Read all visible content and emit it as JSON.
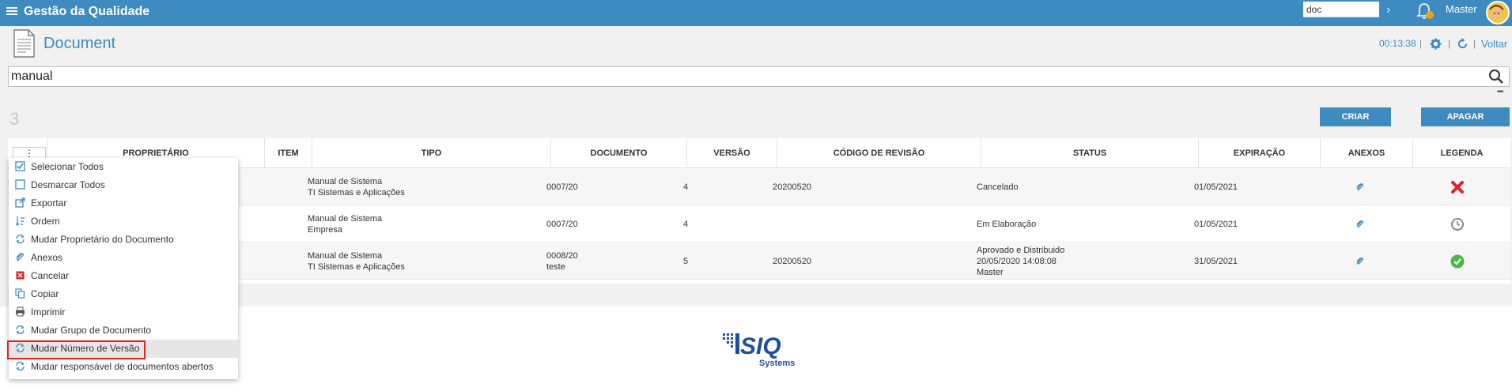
{
  "app": {
    "title": "Gestão da Qualidade"
  },
  "topbar": {
    "search_value": "doc",
    "user_name": "Master"
  },
  "page": {
    "title": "Document",
    "timer": "00:13:38",
    "back_label": "Voltar"
  },
  "search": {
    "value": "manual"
  },
  "results": {
    "count": "3"
  },
  "actions": {
    "create_label": "CRIAR",
    "delete_label": "APAGAR"
  },
  "table": {
    "menu_toggle": "⋮",
    "columns": [
      "PROPRIETÁRIO",
      "ITEM",
      "TIPO",
      "DOCUMENTO",
      "VERSÃO",
      "CÓDIGO DE REVISÃO",
      "STATUS",
      "EXPIRAÇÃO",
      "ANEXOS",
      "LEGENDA"
    ],
    "rows": [
      {
        "tipo_1": "Manual de Sistema",
        "tipo_2": "TI Sistemas e Aplicações",
        "documento_1": "0007/20",
        "documento_2": "",
        "versao": "4",
        "codigo_revisao": "20200520",
        "status_1": "Cancelado",
        "status_2": "",
        "status_3": "",
        "expiracao": "01/05/2021",
        "legenda": "cancelled-icon"
      },
      {
        "tipo_1": "Manual de Sistema",
        "tipo_2": "Empresa",
        "documento_1": "0007/20",
        "documento_2": "",
        "versao": "4",
        "codigo_revisao": "",
        "status_1": "Em Elaboração",
        "status_2": "",
        "status_3": "",
        "expiracao": "01/05/2021",
        "legenda": "clock-icon"
      },
      {
        "tipo_1": "Manual de Sistema",
        "tipo_2": "TI Sistemas e Aplicações",
        "documento_1": "0008/20",
        "documento_2": "teste",
        "versao": "5",
        "codigo_revisao": "20200520",
        "status_1": "Aprovado e Distribuido",
        "status_2": "20/05/2020 14:08:08",
        "status_3": "Master",
        "expiracao": "31/05/2021",
        "legenda": "check-icon"
      }
    ]
  },
  "menu": {
    "items": [
      {
        "label": "Selecionar Todos",
        "icon": "checkbox-checked-icon"
      },
      {
        "label": "Desmarcar Todos",
        "icon": "checkbox-empty-icon"
      },
      {
        "label": "Exportar",
        "icon": "export-icon"
      },
      {
        "label": "Ordem",
        "icon": "sort-icon"
      },
      {
        "label": "Mudar Proprietário do Documento",
        "icon": "refresh-icon"
      },
      {
        "label": "Anexos",
        "icon": "paperclip-icon"
      },
      {
        "label": "Cancelar",
        "icon": "cancel-icon"
      },
      {
        "label": "Copiar",
        "icon": "copy-icon"
      },
      {
        "label": "Imprimir",
        "icon": "printer-icon"
      },
      {
        "label": "Mudar Grupo de Documento",
        "icon": "refresh-icon"
      },
      {
        "label": "Mudar Número de Versão",
        "icon": "refresh-icon"
      },
      {
        "label": "Mudar responsável de documentos abertos",
        "icon": "refresh-icon"
      }
    ]
  },
  "logo": {
    "line1": "SIQ",
    "line2": "Systems"
  },
  "colors": {
    "brand": "#3d8bc0",
    "danger": "#d9252a",
    "success": "#4cb648",
    "muted": "#888888"
  }
}
